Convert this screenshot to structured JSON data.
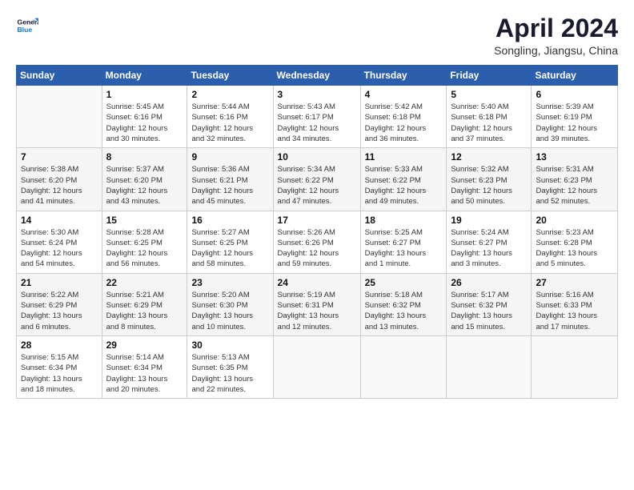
{
  "logo": {
    "line1": "General",
    "line2": "Blue"
  },
  "title": "April 2024",
  "subtitle": "Songling, Jiangsu, China",
  "days_of_week": [
    "Sunday",
    "Monday",
    "Tuesday",
    "Wednesday",
    "Thursday",
    "Friday",
    "Saturday"
  ],
  "weeks": [
    [
      {
        "day": "",
        "info": ""
      },
      {
        "day": "1",
        "info": "Sunrise: 5:45 AM\nSunset: 6:16 PM\nDaylight: 12 hours\nand 30 minutes."
      },
      {
        "day": "2",
        "info": "Sunrise: 5:44 AM\nSunset: 6:16 PM\nDaylight: 12 hours\nand 32 minutes."
      },
      {
        "day": "3",
        "info": "Sunrise: 5:43 AM\nSunset: 6:17 PM\nDaylight: 12 hours\nand 34 minutes."
      },
      {
        "day": "4",
        "info": "Sunrise: 5:42 AM\nSunset: 6:18 PM\nDaylight: 12 hours\nand 36 minutes."
      },
      {
        "day": "5",
        "info": "Sunrise: 5:40 AM\nSunset: 6:18 PM\nDaylight: 12 hours\nand 37 minutes."
      },
      {
        "day": "6",
        "info": "Sunrise: 5:39 AM\nSunset: 6:19 PM\nDaylight: 12 hours\nand 39 minutes."
      }
    ],
    [
      {
        "day": "7",
        "info": "Sunrise: 5:38 AM\nSunset: 6:20 PM\nDaylight: 12 hours\nand 41 minutes."
      },
      {
        "day": "8",
        "info": "Sunrise: 5:37 AM\nSunset: 6:20 PM\nDaylight: 12 hours\nand 43 minutes."
      },
      {
        "day": "9",
        "info": "Sunrise: 5:36 AM\nSunset: 6:21 PM\nDaylight: 12 hours\nand 45 minutes."
      },
      {
        "day": "10",
        "info": "Sunrise: 5:34 AM\nSunset: 6:22 PM\nDaylight: 12 hours\nand 47 minutes."
      },
      {
        "day": "11",
        "info": "Sunrise: 5:33 AM\nSunset: 6:22 PM\nDaylight: 12 hours\nand 49 minutes."
      },
      {
        "day": "12",
        "info": "Sunrise: 5:32 AM\nSunset: 6:23 PM\nDaylight: 12 hours\nand 50 minutes."
      },
      {
        "day": "13",
        "info": "Sunrise: 5:31 AM\nSunset: 6:23 PM\nDaylight: 12 hours\nand 52 minutes."
      }
    ],
    [
      {
        "day": "14",
        "info": "Sunrise: 5:30 AM\nSunset: 6:24 PM\nDaylight: 12 hours\nand 54 minutes."
      },
      {
        "day": "15",
        "info": "Sunrise: 5:28 AM\nSunset: 6:25 PM\nDaylight: 12 hours\nand 56 minutes."
      },
      {
        "day": "16",
        "info": "Sunrise: 5:27 AM\nSunset: 6:25 PM\nDaylight: 12 hours\nand 58 minutes."
      },
      {
        "day": "17",
        "info": "Sunrise: 5:26 AM\nSunset: 6:26 PM\nDaylight: 12 hours\nand 59 minutes."
      },
      {
        "day": "18",
        "info": "Sunrise: 5:25 AM\nSunset: 6:27 PM\nDaylight: 13 hours\nand 1 minute."
      },
      {
        "day": "19",
        "info": "Sunrise: 5:24 AM\nSunset: 6:27 PM\nDaylight: 13 hours\nand 3 minutes."
      },
      {
        "day": "20",
        "info": "Sunrise: 5:23 AM\nSunset: 6:28 PM\nDaylight: 13 hours\nand 5 minutes."
      }
    ],
    [
      {
        "day": "21",
        "info": "Sunrise: 5:22 AM\nSunset: 6:29 PM\nDaylight: 13 hours\nand 6 minutes."
      },
      {
        "day": "22",
        "info": "Sunrise: 5:21 AM\nSunset: 6:29 PM\nDaylight: 13 hours\nand 8 minutes."
      },
      {
        "day": "23",
        "info": "Sunrise: 5:20 AM\nSunset: 6:30 PM\nDaylight: 13 hours\nand 10 minutes."
      },
      {
        "day": "24",
        "info": "Sunrise: 5:19 AM\nSunset: 6:31 PM\nDaylight: 13 hours\nand 12 minutes."
      },
      {
        "day": "25",
        "info": "Sunrise: 5:18 AM\nSunset: 6:32 PM\nDaylight: 13 hours\nand 13 minutes."
      },
      {
        "day": "26",
        "info": "Sunrise: 5:17 AM\nSunset: 6:32 PM\nDaylight: 13 hours\nand 15 minutes."
      },
      {
        "day": "27",
        "info": "Sunrise: 5:16 AM\nSunset: 6:33 PM\nDaylight: 13 hours\nand 17 minutes."
      }
    ],
    [
      {
        "day": "28",
        "info": "Sunrise: 5:15 AM\nSunset: 6:34 PM\nDaylight: 13 hours\nand 18 minutes."
      },
      {
        "day": "29",
        "info": "Sunrise: 5:14 AM\nSunset: 6:34 PM\nDaylight: 13 hours\nand 20 minutes."
      },
      {
        "day": "30",
        "info": "Sunrise: 5:13 AM\nSunset: 6:35 PM\nDaylight: 13 hours\nand 22 minutes."
      },
      {
        "day": "",
        "info": ""
      },
      {
        "day": "",
        "info": ""
      },
      {
        "day": "",
        "info": ""
      },
      {
        "day": "",
        "info": ""
      }
    ]
  ]
}
